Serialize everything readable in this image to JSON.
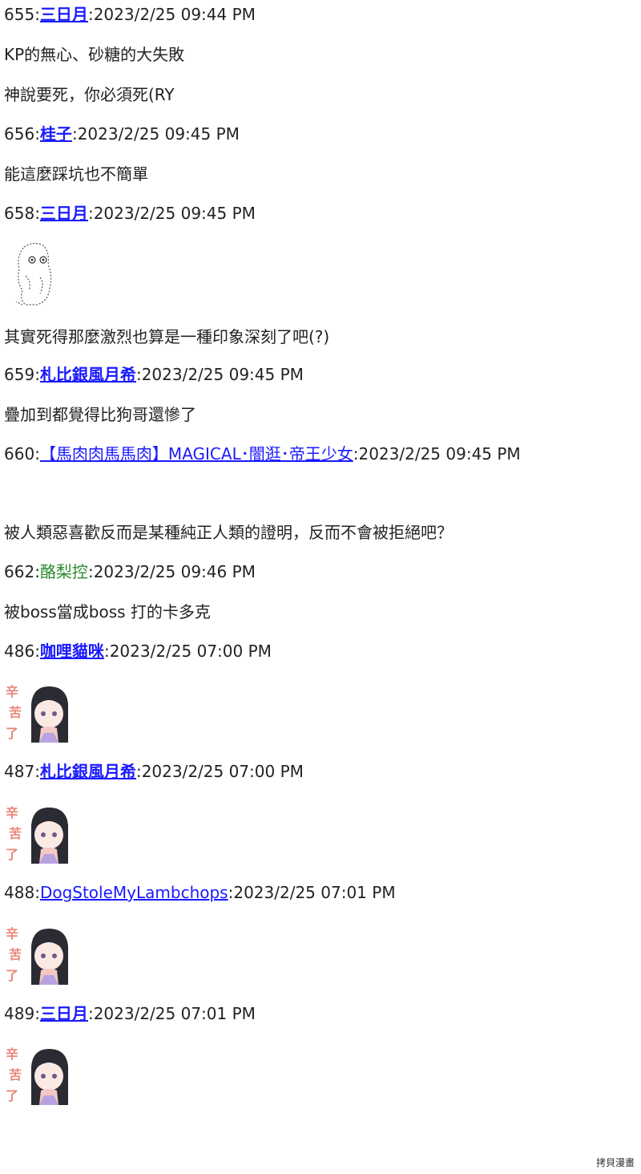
{
  "posts": [
    {
      "num": "655",
      "name": "三日月",
      "time": "2023/2/25 09:44 PM"
    },
    {
      "num": "656",
      "name": "桂子",
      "time": "2023/2/25 09:45 PM"
    },
    {
      "num": "658",
      "name": "三日月",
      "time": "2023/2/25 09:45 PM"
    },
    {
      "num": "659",
      "name": "札比銀風月希",
      "time": "2023/2/25 09:45 PM"
    },
    {
      "num": "660",
      "name": "【馬肉肉馬馬肉】MAGICAL･闇逛･帝王少女",
      "time": "2023/2/25 09:45 PM"
    },
    {
      "num": "662",
      "name": "酪梨控",
      "time": "2023/2/25 09:46 PM"
    },
    {
      "num": "486",
      "name": "咖哩貓咪",
      "time": "2023/2/25 07:00 PM"
    },
    {
      "num": "487",
      "name": "札比銀風月希",
      "time": "2023/2/25 07:00 PM"
    },
    {
      "num": "488",
      "name": "DogStoleMyLambchops",
      "time": "2023/2/25 07:01 PM"
    },
    {
      "num": "489",
      "name": "三日月",
      "time": "2023/2/25 07:01 PM"
    }
  ],
  "messages": [
    "KP的無心、砂糖的大失敗",
    "神說要死，你必須死(RY",
    "能這麼踩坑也不簡單",
    "其實死得那麼激烈也算是一種印象深刻了吧(?)",
    "疊加到都覺得比狗哥還慘了",
    "被人類惡喜歡反而是某種純正人類的證明，反而不會被拒絕吧？",
    "被boss當成boss 打的卡多克"
  ],
  "sticker_text": "辛苦了",
  "separator": ":",
  "footer": "拷貝漫畫"
}
